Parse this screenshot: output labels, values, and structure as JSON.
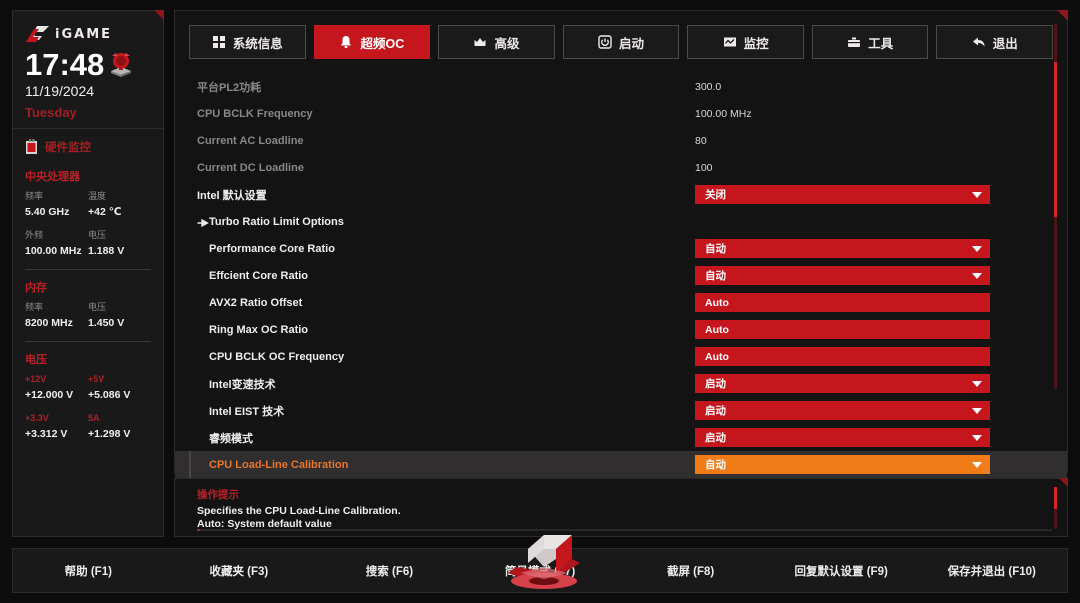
{
  "brand": {
    "name": "iGAME",
    "logo_icon": "igame-logo-icon"
  },
  "clock": {
    "time": "17:48",
    "date": "11/19/2024",
    "weekday": "Tuesday",
    "badge_icon": "alarm-clock-icon"
  },
  "sidebar": {
    "monitor_header": {
      "label": "硬件监控",
      "icon": "hardware-monitor-icon"
    },
    "groups": [
      {
        "title": "中央处理器",
        "entries": [
          {
            "key": "频率",
            "value": "5.40 GHz",
            "key_red": false
          },
          {
            "key": "温度",
            "value": "+42 ℃",
            "key_red": false
          },
          {
            "key": "外频",
            "value": "100.00 MHz",
            "key_red": false
          },
          {
            "key": "电压",
            "value": "1.188 V",
            "key_red": false
          }
        ]
      },
      {
        "title": "内存",
        "entries": [
          {
            "key": "频率",
            "value": "8200 MHz",
            "key_red": false
          },
          {
            "key": "电压",
            "value": "1.450 V",
            "key_red": false
          }
        ]
      },
      {
        "title": "电压",
        "entries": [
          {
            "key": "+12V",
            "value": "+12.000 V",
            "key_red": true
          },
          {
            "key": "+5V",
            "value": "+5.086 V",
            "key_red": true
          },
          {
            "key": "+3.3V",
            "value": "+3.312 V",
            "key_red": true
          },
          {
            "key": "5A",
            "value": "+1.298 V",
            "key_red": true
          }
        ]
      }
    ]
  },
  "tabs": [
    {
      "label": "系统信息",
      "icon": "grid-squares-icon",
      "active": false
    },
    {
      "label": "超频OC",
      "icon": "bell-icon",
      "active": true
    },
    {
      "label": "高级",
      "icon": "crown-icon",
      "active": false
    },
    {
      "label": "启动",
      "icon": "power-icon",
      "active": false
    },
    {
      "label": "监控",
      "icon": "chart-monitor-icon",
      "active": false
    },
    {
      "label": "工具",
      "icon": "toolbox-icon",
      "active": false
    },
    {
      "label": "退出",
      "icon": "arrow-back-icon",
      "active": false
    }
  ],
  "rows": [
    {
      "label": "平台PL2功耗",
      "kind": "text",
      "style": "dim",
      "value": "300.0"
    },
    {
      "label": "CPU BCLK Frequency",
      "kind": "text",
      "style": "dim",
      "value": "100.00 MHz"
    },
    {
      "label": "Current AC Loadline",
      "kind": "text",
      "style": "dim",
      "value": "80"
    },
    {
      "label": "Current DC Loadline",
      "kind": "text",
      "style": "dim",
      "value": "100"
    },
    {
      "label": "Intel 默认设置",
      "kind": "dropdown",
      "style": "normal",
      "value": "关闭"
    },
    {
      "label": "Turbo Ratio Limit Options",
      "kind": "submenu",
      "style": "normal",
      "value": "",
      "arrow_icon": "submenu-arrow-icon"
    },
    {
      "label": "Performance Core Ratio",
      "kind": "dropdown",
      "style": "normal",
      "value": "自动",
      "indent": true
    },
    {
      "label": "Effcient Core Ratio",
      "kind": "dropdown",
      "style": "normal",
      "value": "自动",
      "indent": true
    },
    {
      "label": "AVX2 Ratio Offset",
      "kind": "field",
      "style": "normal",
      "value": "Auto",
      "indent": true
    },
    {
      "label": "Ring Max OC Ratio",
      "kind": "field",
      "style": "normal",
      "value": "Auto",
      "indent": true
    },
    {
      "label": "CPU BCLK OC Frequency",
      "kind": "field",
      "style": "normal",
      "value": "Auto",
      "indent": true
    },
    {
      "label": "Intel变速技术",
      "kind": "dropdown",
      "style": "normal",
      "value": "启动",
      "indent": true
    },
    {
      "label": "Intel EIST 技术",
      "kind": "dropdown",
      "style": "normal",
      "value": "启动",
      "indent": true
    },
    {
      "label": "睿频模式",
      "kind": "dropdown",
      "style": "normal",
      "value": "启动",
      "indent": true
    },
    {
      "label": "CPU Load-Line Calibration",
      "kind": "dropdown",
      "style": "selected",
      "value": "自动",
      "indent": true,
      "selected": true
    }
  ],
  "help": {
    "title": "操作提示",
    "line1": "Specifies the CPU Load-Line Calibration.",
    "line2": "Auto: System default value"
  },
  "footer": {
    "keys": [
      {
        "label": "帮助 (F1)"
      },
      {
        "label": "收藏夹 (F3)"
      },
      {
        "label": "搜索 (F6)"
      },
      {
        "label": "简易模式 (F7)"
      },
      {
        "label": "截屏 (F8)"
      },
      {
        "label": "回复默认设置 (F9)"
      },
      {
        "label": "保存并退出 (F10)"
      }
    ],
    "emblem_icon": "colorful-emblem-icon"
  },
  "colors": {
    "accent_red": "#c4161c",
    "accent_orange": "#f07c18",
    "panel_bg": "#141313",
    "sidebar_bg": "#1a1919",
    "selected_row": "#302e2e"
  }
}
